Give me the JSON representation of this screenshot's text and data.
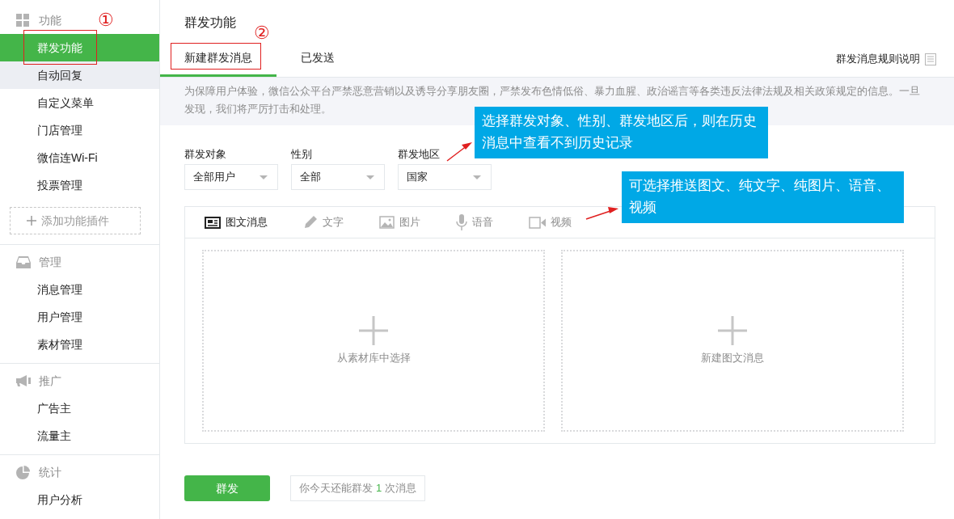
{
  "sidebar": {
    "sections": [
      {
        "kind": "grid",
        "title": "功能",
        "items": [
          {
            "label": "群发功能",
            "selected": true,
            "hovered": false
          },
          {
            "label": "自动回复",
            "selected": false,
            "hovered": true
          },
          {
            "label": "自定义菜单",
            "selected": false,
            "hovered": false
          },
          {
            "label": "门店管理",
            "selected": false,
            "hovered": false
          },
          {
            "label": "微信连Wi-Fi",
            "selected": false,
            "hovered": false
          },
          {
            "label": "投票管理",
            "selected": false,
            "hovered": false
          }
        ],
        "add_button": "添加功能插件"
      },
      {
        "kind": "inbox",
        "title": "管理",
        "items": [
          {
            "label": "消息管理",
            "selected": false,
            "hovered": false
          },
          {
            "label": "用户管理",
            "selected": false,
            "hovered": false
          },
          {
            "label": "素材管理",
            "selected": false,
            "hovered": false
          }
        ]
      },
      {
        "kind": "megaphone",
        "title": "推广",
        "items": [
          {
            "label": "广告主",
            "selected": false,
            "hovered": false
          },
          {
            "label": "流量主",
            "selected": false,
            "hovered": false
          }
        ]
      },
      {
        "kind": "pie",
        "title": "统计",
        "items": [
          {
            "label": "用户分析",
            "selected": false,
            "hovered": false
          }
        ]
      }
    ]
  },
  "page_title": "群发功能",
  "tabs": [
    {
      "label": "新建群发消息",
      "selected": true
    },
    {
      "label": "已发送",
      "selected": false
    }
  ],
  "rules_link": "群发消息规则说明",
  "notice": "为保障用户体验，微信公众平台严禁恶意营销以及诱导分享朋友圈，严禁发布色情低俗、暴力血腥、政治谣言等各类违反法律法规及相关政策规定的信息。一旦发现，我们将严厉打击和处理。",
  "filters": [
    {
      "label": "群发对象",
      "value": "全部用户"
    },
    {
      "label": "性别",
      "value": "全部"
    },
    {
      "label": "群发地区",
      "value": "国家"
    }
  ],
  "message_types": [
    {
      "kind": "news",
      "label": "图文消息",
      "selected": true
    },
    {
      "kind": "text",
      "label": "文字",
      "selected": false
    },
    {
      "kind": "image",
      "label": "图片",
      "selected": false
    },
    {
      "kind": "voice",
      "label": "语音",
      "selected": false
    },
    {
      "kind": "video",
      "label": "视频",
      "selected": false
    }
  ],
  "compose_cards": [
    {
      "label": "从素材库中选择"
    },
    {
      "label": "新建图文消息"
    }
  ],
  "send_button": "群发",
  "quota": {
    "prefix": "你今天还能群发",
    "count": "1",
    "suffix": "次消息"
  },
  "annotations": {
    "markers": [
      "①",
      "②"
    ],
    "callouts": [
      "选择群发对象、性别、群发地区后，则在历史消息中查看不到历史记录",
      "可选择推送图文、纯文字、纯图片、语音、视频"
    ]
  }
}
